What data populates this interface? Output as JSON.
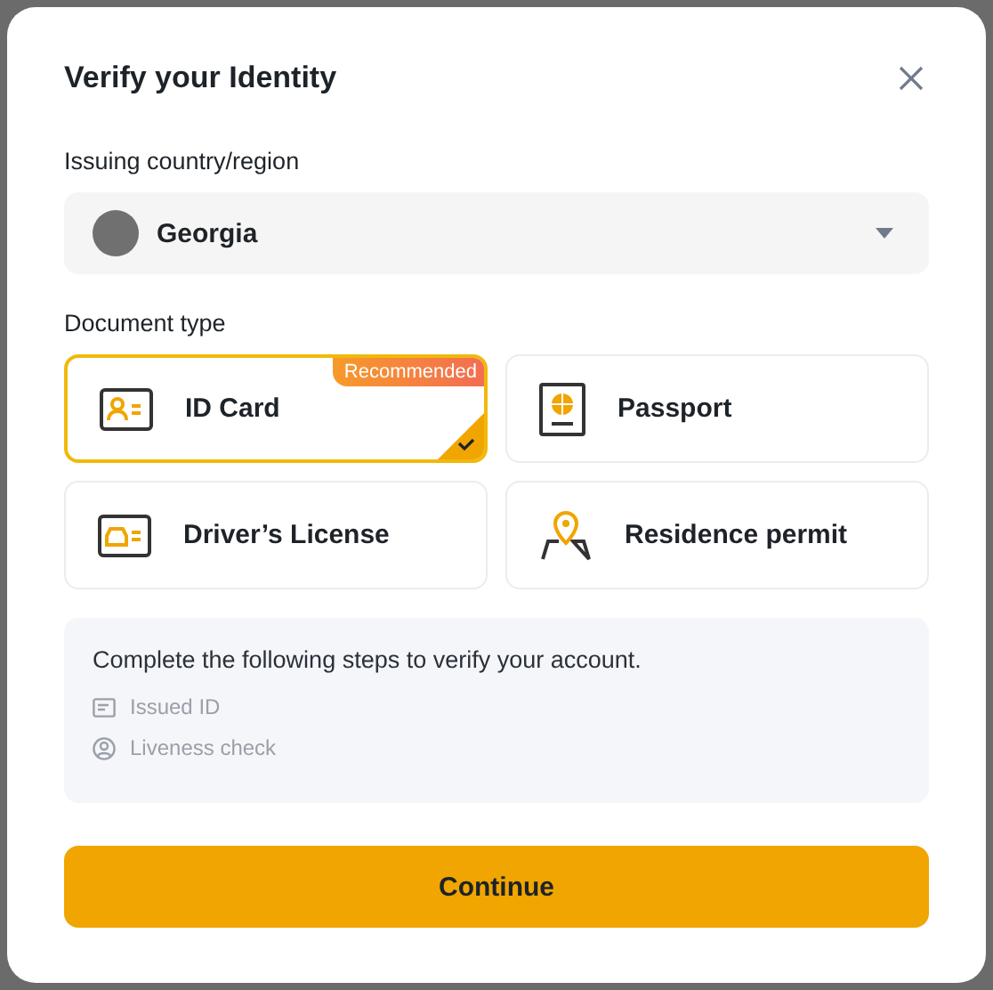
{
  "dialog": {
    "title": "Verify your Identity"
  },
  "country": {
    "label": "Issuing country/region",
    "value": "Georgia"
  },
  "document_type": {
    "label": "Document type",
    "options": [
      {
        "kind": "id",
        "label": "ID Card",
        "selected": true,
        "badge": "Recommended"
      },
      {
        "kind": "passport",
        "label": "Passport",
        "selected": false
      },
      {
        "kind": "driver",
        "label": "Driver’s License",
        "selected": false
      },
      {
        "kind": "residence",
        "label": "Residence permit",
        "selected": false
      }
    ]
  },
  "info": {
    "text": "Complete the following steps to verify your account.",
    "steps": [
      {
        "kind": "card",
        "label": "Issued ID"
      },
      {
        "kind": "person",
        "label": "Liveness check"
      }
    ]
  },
  "buttons": [
    "Continue"
  ]
}
